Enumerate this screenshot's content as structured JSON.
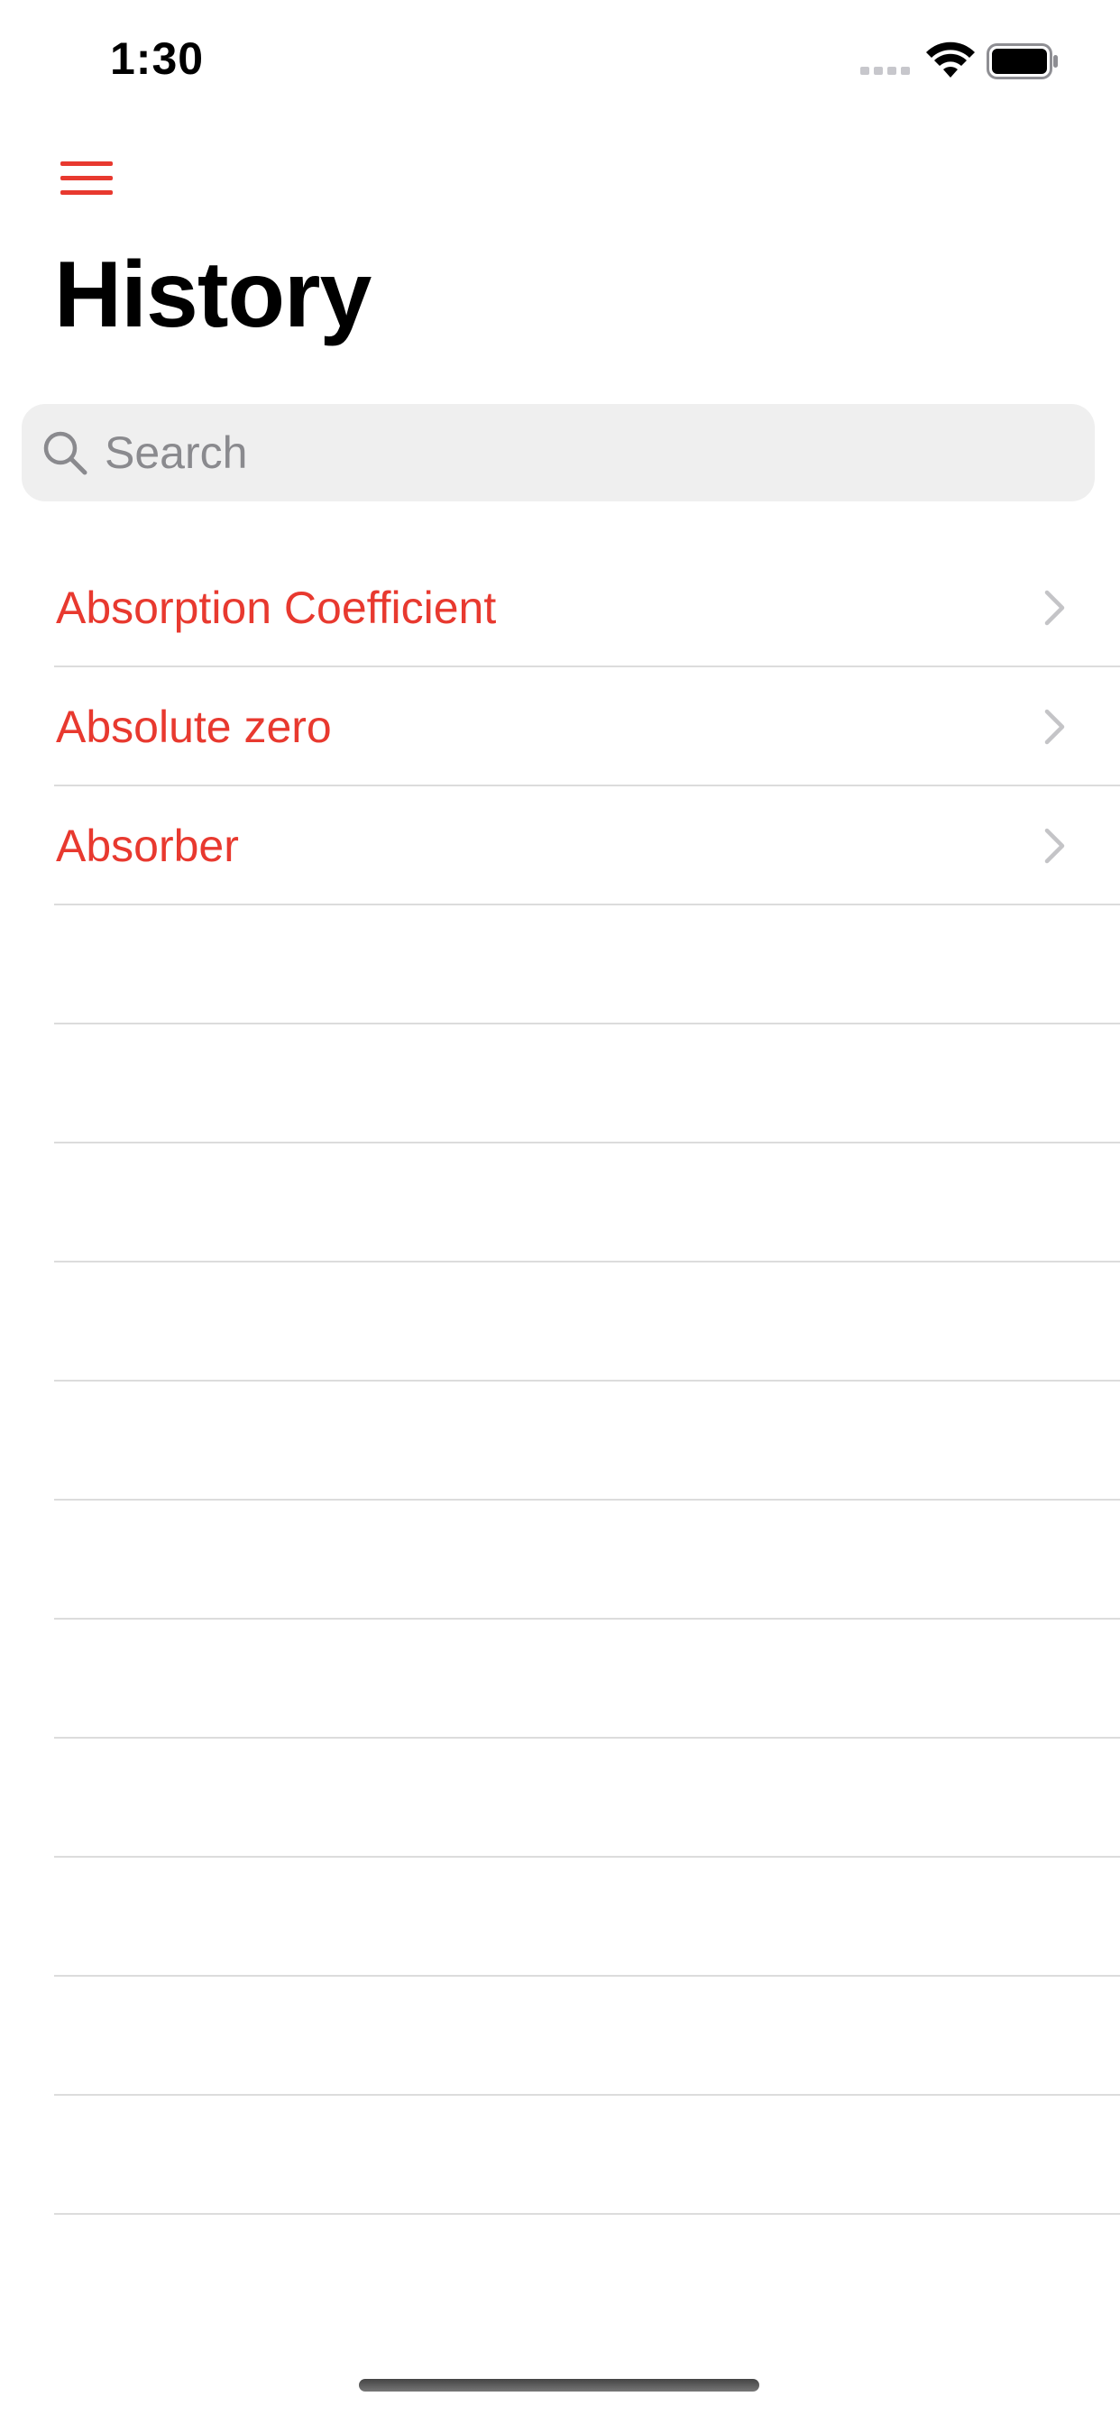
{
  "status_bar": {
    "time": "1:30",
    "signal_icon": "signal-dots-icon",
    "wifi_icon": "wifi-icon",
    "battery_icon": "battery-full-icon"
  },
  "nav": {
    "menu_icon": "hamburger-menu-icon",
    "title": "History"
  },
  "search": {
    "placeholder": "Search",
    "value": "",
    "icon": "search-icon"
  },
  "history": {
    "items": [
      {
        "label": "Absorption Coefficient"
      },
      {
        "label": "Absolute zero"
      },
      {
        "label": "Absorber"
      }
    ],
    "empty_row_count": 11
  },
  "colors": {
    "accent": "#e8392f",
    "separator": "#dcdcdc",
    "search_background": "#efefef",
    "placeholder": "#8a8a8e",
    "chevron": "#c4c4c7"
  }
}
